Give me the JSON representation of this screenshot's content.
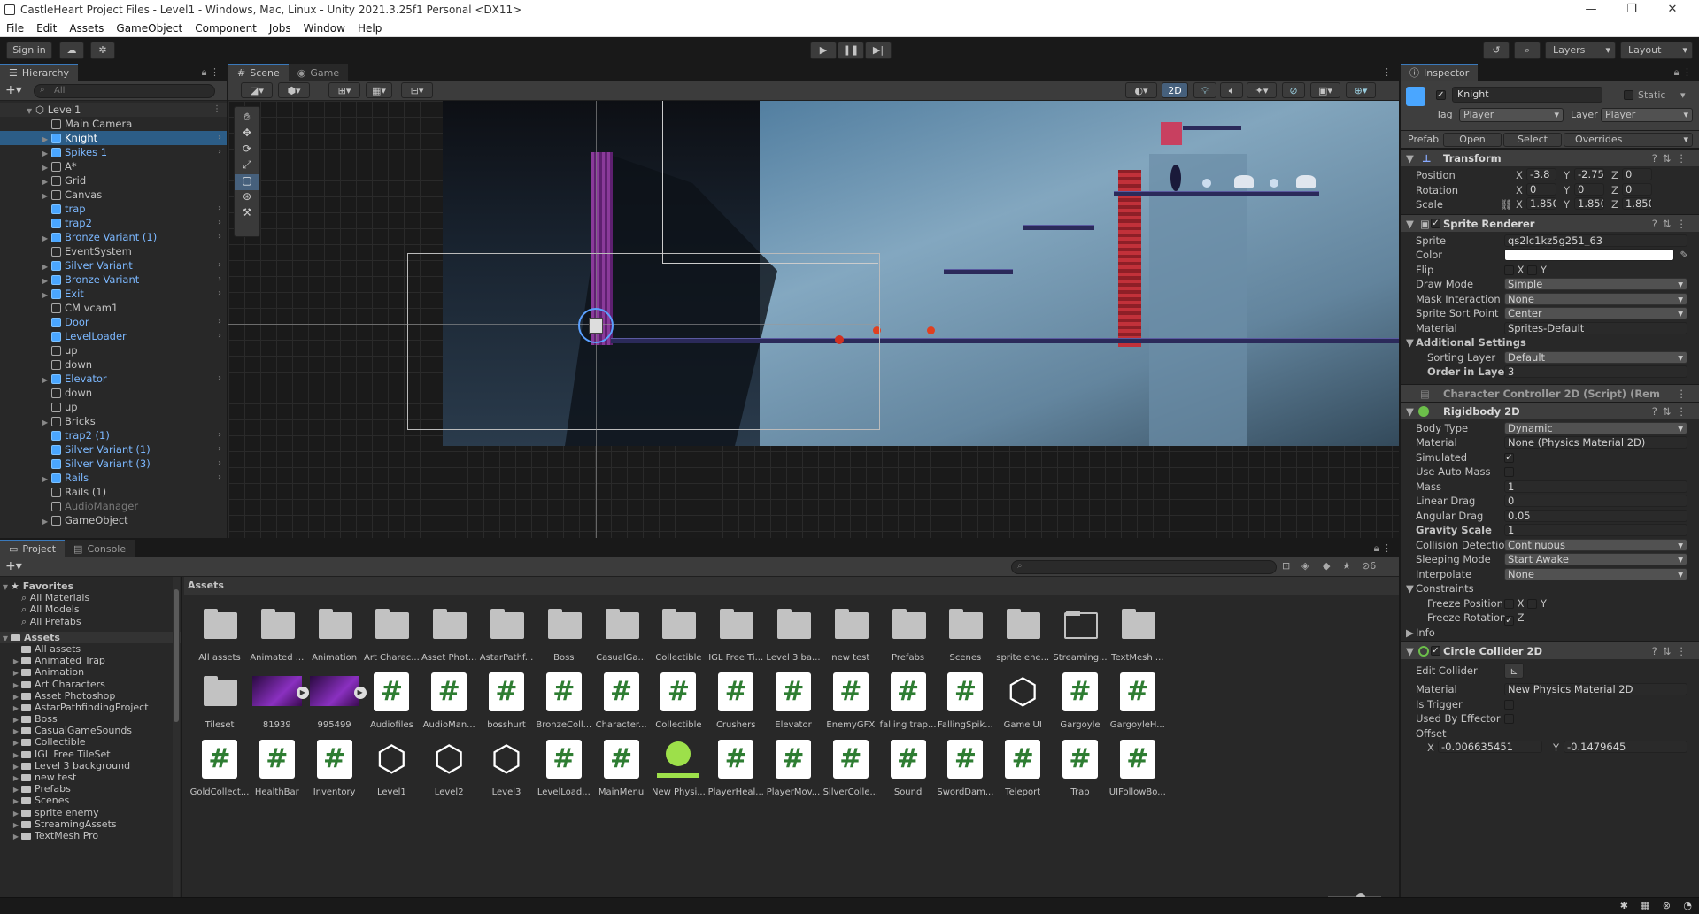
{
  "window": {
    "title": "CastleHeart Project Files - Level1 - Windows, Mac, Linux - Unity 2021.3.25f1 Personal <DX11>"
  },
  "menu": [
    "File",
    "Edit",
    "Assets",
    "GameObject",
    "Component",
    "Jobs",
    "Window",
    "Help"
  ],
  "toolbar": {
    "sign_in": "Sign in",
    "layers": "Layers",
    "layout": "Layout"
  },
  "hierarchy": {
    "tab": "Hierarchy",
    "search_placeholder": "All",
    "scene": "Level1",
    "items": [
      {
        "label": "Main Camera"
      },
      {
        "label": "Knight"
      },
      {
        "label": "Spikes 1"
      },
      {
        "label": "A*"
      },
      {
        "label": "Grid"
      },
      {
        "label": "Canvas"
      },
      {
        "label": "trap"
      },
      {
        "label": "trap2"
      },
      {
        "label": "Bronze Variant (1)"
      },
      {
        "label": "EventSystem"
      },
      {
        "label": "Silver Variant"
      },
      {
        "label": "Bronze Variant"
      },
      {
        "label": "Exit"
      },
      {
        "label": "CM vcam1"
      },
      {
        "label": "Door"
      },
      {
        "label": "LevelLoader"
      },
      {
        "label": "up"
      },
      {
        "label": "down"
      },
      {
        "label": "Elevator"
      },
      {
        "label": "down"
      },
      {
        "label": "up"
      },
      {
        "label": "Bricks"
      },
      {
        "label": "trap2 (1)"
      },
      {
        "label": "Silver Variant (1)"
      },
      {
        "label": "Silver Variant (3)"
      },
      {
        "label": "Rails"
      },
      {
        "label": "Rails (1)"
      },
      {
        "label": "AudioManager"
      },
      {
        "label": "GameObject"
      }
    ]
  },
  "scene_tabs": {
    "scene": "Scene",
    "game": "Game",
    "mode2d": "2D"
  },
  "project": {
    "tabs": {
      "project": "Project",
      "console": "Console"
    },
    "hidden_count": "6",
    "favorites_label": "Favorites",
    "favorites": [
      "All Materials",
      "All Models",
      "All Prefabs"
    ],
    "assets_label": "Assets",
    "tree": [
      "All assets",
      "Animated Trap",
      "Animation",
      "Art Characters",
      "Asset Photoshop",
      "AstarPathfindingProject",
      "Boss",
      "CasualGameSounds",
      "Collectible",
      "IGL Free TileSet",
      "Level 3 background",
      "new test",
      "Prefabs",
      "Scenes",
      "sprite enemy",
      "StreamingAssets",
      "TextMesh Pro"
    ],
    "breadcrumb": "Assets",
    "grid": [
      {
        "label": "All assets",
        "kind": "folder"
      },
      {
        "label": "Animated ...",
        "kind": "folder"
      },
      {
        "label": "Animation",
        "kind": "folder"
      },
      {
        "label": "Art Charac...",
        "kind": "folder"
      },
      {
        "label": "Asset Phot...",
        "kind": "folder"
      },
      {
        "label": "AstarPathf...",
        "kind": "folder"
      },
      {
        "label": "Boss",
        "kind": "folder"
      },
      {
        "label": "CasualGa...",
        "kind": "folder"
      },
      {
        "label": "Collectible",
        "kind": "folder"
      },
      {
        "label": "IGL Free Ti...",
        "kind": "folder"
      },
      {
        "label": "Level 3 ba...",
        "kind": "folder"
      },
      {
        "label": "new test",
        "kind": "folder"
      },
      {
        "label": "Prefabs",
        "kind": "folder"
      },
      {
        "label": "Scenes",
        "kind": "folder"
      },
      {
        "label": "sprite ene...",
        "kind": "folder"
      },
      {
        "label": "Streaming...",
        "kind": "folder-empty"
      },
      {
        "label": "TextMesh ...",
        "kind": "folder"
      },
      {
        "label": "Tileset",
        "kind": "folder"
      },
      {
        "label": "81939",
        "kind": "video"
      },
      {
        "label": "995499",
        "kind": "video"
      },
      {
        "label": "Audiofiles",
        "kind": "script"
      },
      {
        "label": "AudioMan...",
        "kind": "script"
      },
      {
        "label": "bosshurt",
        "kind": "script"
      },
      {
        "label": "BronzeColl...",
        "kind": "script"
      },
      {
        "label": "Character...",
        "kind": "script"
      },
      {
        "label": "Collectible",
        "kind": "script"
      },
      {
        "label": "Crushers",
        "kind": "script"
      },
      {
        "label": "Elevator",
        "kind": "script"
      },
      {
        "label": "EnemyGFX",
        "kind": "script"
      },
      {
        "label": "falling trap...",
        "kind": "script"
      },
      {
        "label": "FallingSpik...",
        "kind": "script"
      },
      {
        "label": "Game UI",
        "kind": "unity"
      },
      {
        "label": "Gargoyle",
        "kind": "script"
      },
      {
        "label": "GargoyleH...",
        "kind": "script"
      },
      {
        "label": "GoldCollect...",
        "kind": "script"
      },
      {
        "label": "HealthBar",
        "kind": "script"
      },
      {
        "label": "Inventory",
        "kind": "script"
      },
      {
        "label": "Level1",
        "kind": "unity"
      },
      {
        "label": "Level2",
        "kind": "unity"
      },
      {
        "label": "Level3",
        "kind": "unity"
      },
      {
        "label": "LevelLoad...",
        "kind": "script"
      },
      {
        "label": "MainMenu",
        "kind": "script"
      },
      {
        "label": "New Physi...",
        "kind": "physics"
      },
      {
        "label": "PlayerHeal...",
        "kind": "script"
      },
      {
        "label": "PlayerMov...",
        "kind": "script"
      },
      {
        "label": "SilverColle...",
        "kind": "script"
      },
      {
        "label": "Sound",
        "kind": "script"
      },
      {
        "label": "SwordDam...",
        "kind": "script"
      },
      {
        "label": "Teleport",
        "kind": "script"
      },
      {
        "label": "Trap",
        "kind": "script"
      },
      {
        "label": "UIFollowBo...",
        "kind": "script"
      }
    ]
  },
  "inspector": {
    "tab": "Inspector",
    "name": "Knight",
    "static": "Static",
    "tag_label": "Tag",
    "tag": "Player",
    "layer_label": "Layer",
    "layer": "Player",
    "prefab_label": "Prefab",
    "open": "Open",
    "select": "Select",
    "overrides": "Overrides",
    "transform": {
      "title": "Transform",
      "position_label": "Position",
      "pos": [
        "-3.8",
        "-2.75",
        "0"
      ],
      "rotation_label": "Rotation",
      "rot": [
        "0",
        "0",
        "0"
      ],
      "scale_label": "Scale",
      "scale": [
        "1.850!",
        "1.850!",
        "1.850!"
      ]
    },
    "sprite_renderer": {
      "title": "Sprite Renderer",
      "sprite_label": "Sprite",
      "sprite": "qs2lc1kz5g251_63",
      "color_label": "Color",
      "flip_label": "Flip",
      "flip_x": "X",
      "flip_y": "Y",
      "draw_mode_label": "Draw Mode",
      "draw_mode": "Simple",
      "mask_label": "Mask Interaction",
      "mask": "None",
      "sort_point_label": "Sprite Sort Point",
      "sort_point": "Center",
      "material_label": "Material",
      "material": "Sprites-Default",
      "additional": "Additional Settings",
      "sorting_layer_label": "Sorting Layer",
      "sorting_layer": "Default",
      "order_label": "Order in Layer",
      "order": "3"
    },
    "char_controller": {
      "title": "Character Controller 2D (Script) (Rem"
    },
    "rigidbody": {
      "title": "Rigidbody 2D",
      "body_type_label": "Body Type",
      "body_type": "Dynamic",
      "material_label": "Material",
      "material": "None (Physics Material 2D)",
      "simulated_label": "Simulated",
      "auto_mass_label": "Use Auto Mass",
      "mass_label": "Mass",
      "mass": "1",
      "linear_drag_label": "Linear Drag",
      "linear_drag": "0",
      "angular_drag_label": "Angular Drag",
      "angular_drag": "0.05",
      "gravity_label": "Gravity Scale",
      "gravity": "1",
      "collision_label": "Collision Detection",
      "collision": "Continuous",
      "sleeping_label": "Sleeping Mode",
      "sleeping": "Start Awake",
      "interpolate_label": "Interpolate",
      "interpolate": "None",
      "constraints_label": "Constraints",
      "freeze_pos_label": "Freeze Position",
      "fx": "X",
      "fy": "Y",
      "freeze_rot_label": "Freeze Rotation",
      "fz": "Z",
      "info_label": "Info"
    },
    "circle_collider": {
      "title": "Circle Collider 2D",
      "edit_label": "Edit Collider",
      "material_label": "Material",
      "material": "New Physics Material 2D",
      "trigger_label": "Is Trigger",
      "effector_label": "Used By Effector",
      "offset_label": "Offset",
      "offset_x": "-0.006635451",
      "offset_y": "-0.1479645"
    }
  }
}
